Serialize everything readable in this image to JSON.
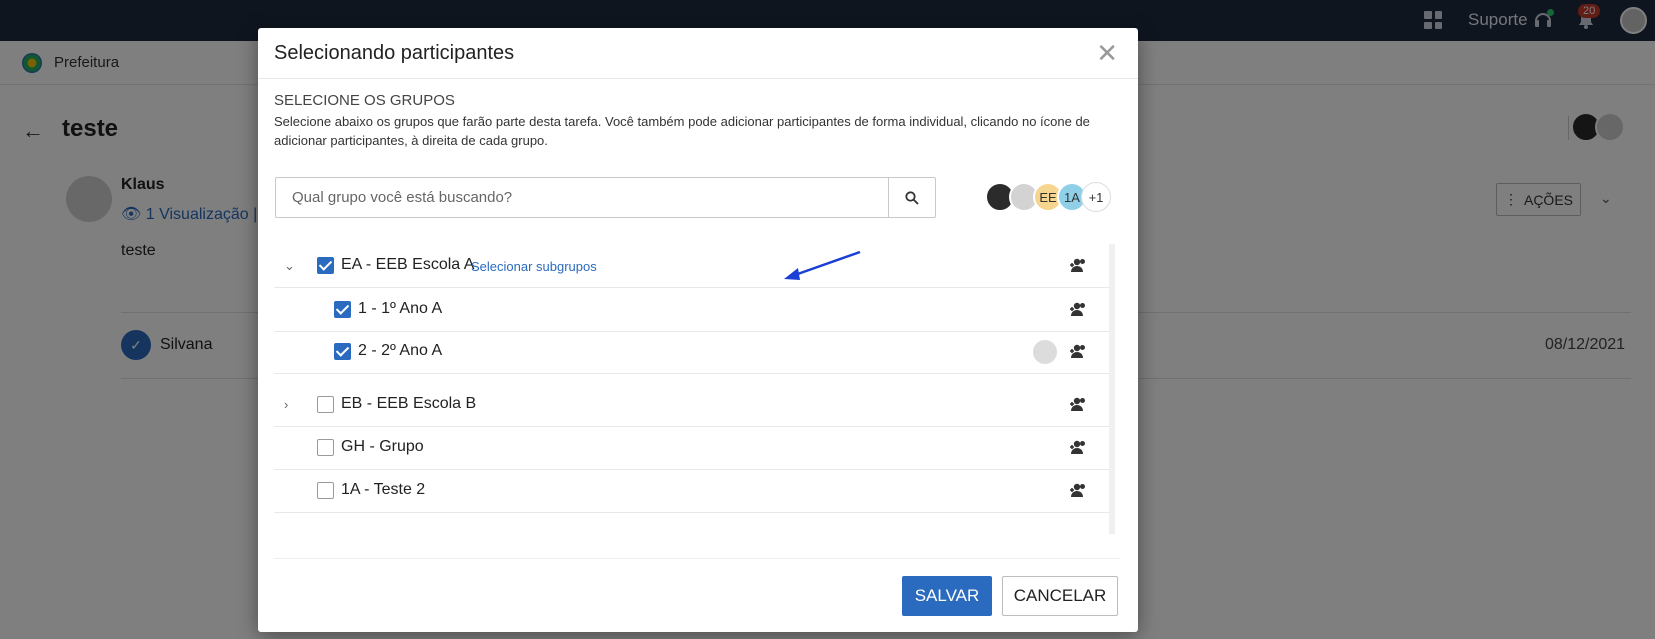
{
  "topbar": {
    "support_label": "Suporte",
    "notification_count": "20"
  },
  "breadcrumb": {
    "org": "Prefeitura"
  },
  "page": {
    "title": "teste",
    "author": "Klaus",
    "views": "1 Visualização",
    "views_sep": "|",
    "post_text": "teste",
    "actions_label": "AÇÕES",
    "participant": {
      "name": "Silvana",
      "date": "08/12/2021"
    }
  },
  "modal": {
    "title": "Selecionando participantes",
    "section_heading": "SELECIONE OS GRUPOS",
    "description": "Selecione abaixo os grupos que farão parte desta tarefa. Você também pode adicionar participantes de forma individual, clicando no ícone de adicionar participantes, à direita de cada grupo.",
    "search_placeholder": "Qual grupo você está buscando?",
    "selected_avatars": [
      {
        "label": "",
        "color": "#2b2b2b"
      },
      {
        "label": "",
        "color": "#d3d3d3"
      },
      {
        "label": "EE",
        "color": "#f6d58e"
      },
      {
        "label": "1A",
        "color": "#8fd0e8"
      },
      {
        "label": "+1",
        "color": "#ffffff"
      }
    ],
    "groups": [
      {
        "label": "EA - EEB Escola A",
        "checked": true,
        "expanded": true,
        "sublink": "Selecionar subgrupos"
      },
      {
        "label": "1 - 1º Ano A",
        "checked": true,
        "child": true
      },
      {
        "label": "2 - 2º Ano A",
        "checked": true,
        "child": true,
        "has_avatar": true
      },
      {
        "label": "EB - EEB Escola B",
        "checked": false,
        "expandable": true
      },
      {
        "label": "GH - Grupo",
        "checked": false
      },
      {
        "label": "1A - Teste 2",
        "checked": false
      }
    ],
    "save_label": "SALVAR",
    "cancel_label": "CANCELAR"
  },
  "colors": {
    "topbar": "#1f2a3f",
    "primary": "#2a6bbf",
    "annotation_arrow": "#1a3fd6"
  }
}
